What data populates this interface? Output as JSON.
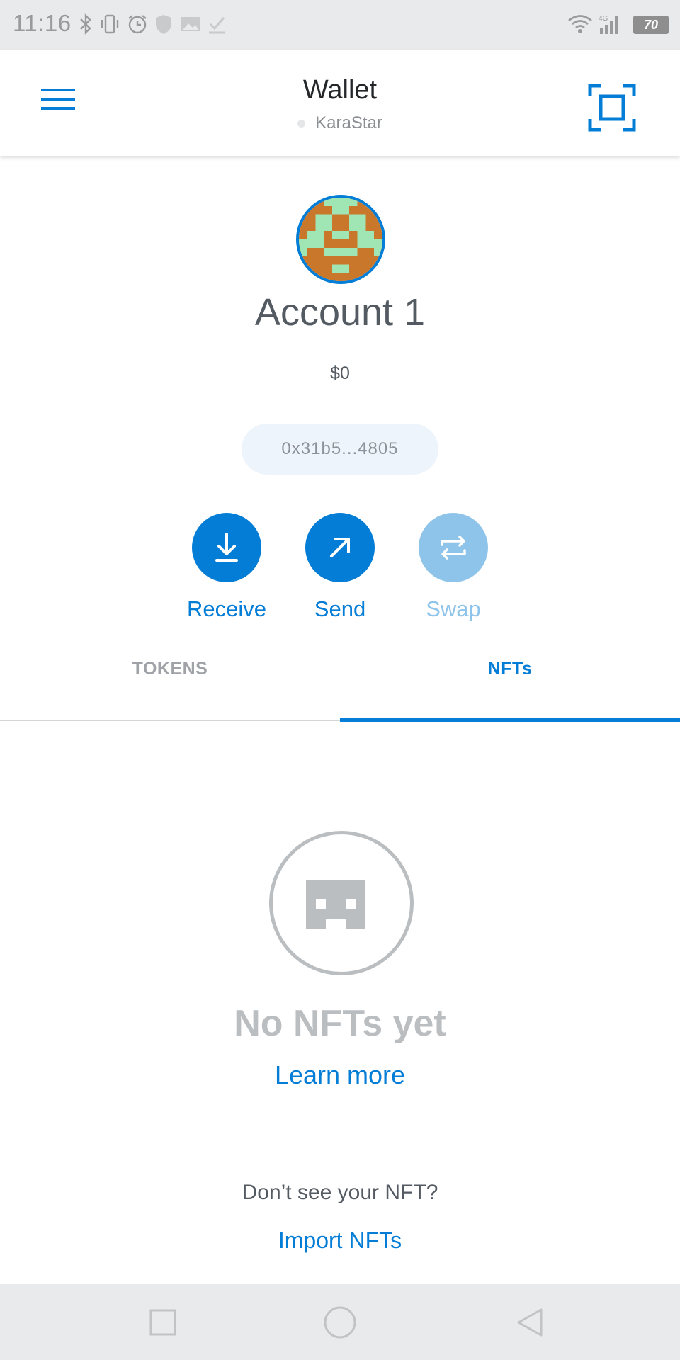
{
  "status_bar": {
    "time": "11:16",
    "battery": "70",
    "network": "4G"
  },
  "header": {
    "title": "Wallet",
    "network_name": "KaraStar"
  },
  "account": {
    "name": "Account 1",
    "balance": "$0",
    "address": "0x31b5...4805"
  },
  "actions": [
    {
      "label": "Receive",
      "icon": "download-icon",
      "enabled": true
    },
    {
      "label": "Send",
      "icon": "arrow-up-right-icon",
      "enabled": true
    },
    {
      "label": "Swap",
      "icon": "swap-icon",
      "enabled": false
    }
  ],
  "tabs": [
    {
      "label": "TOKENS",
      "active": false
    },
    {
      "label": "NFTs",
      "active": true
    }
  ],
  "empty_state": {
    "title": "No NFTs yet",
    "link": "Learn more"
  },
  "footer": {
    "question": "Don’t see your NFT?",
    "import_link": "Import NFTs"
  },
  "colors": {
    "accent": "#037dd6",
    "accent_disabled": "#8fc4ea",
    "muted": "#bbbec1",
    "text": "#535a61"
  }
}
